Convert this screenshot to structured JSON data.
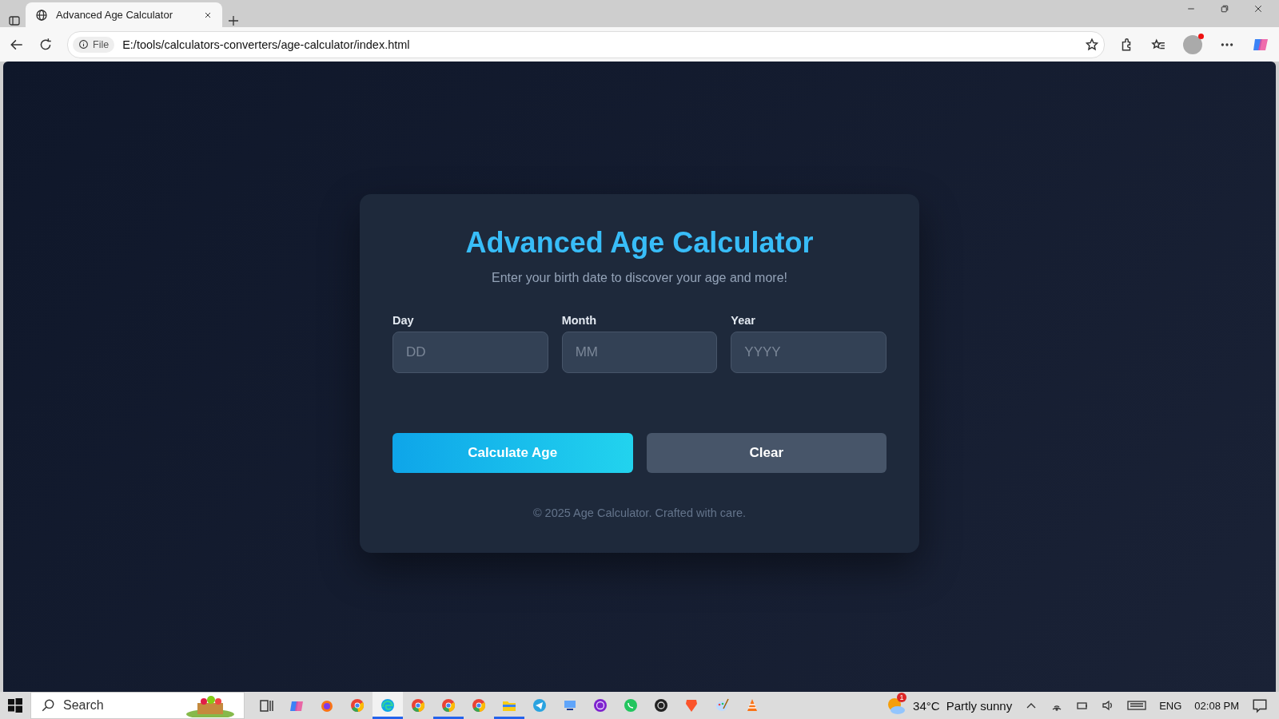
{
  "browser": {
    "tab": {
      "title": "Advanced Age Calculator"
    },
    "address": {
      "scheme_label": "File",
      "url": "E:/tools/calculators-converters/age-calculator/index.html"
    }
  },
  "card": {
    "title": "Advanced Age Calculator",
    "subtitle": "Enter your birth date to discover your age and more!",
    "fields": [
      {
        "label": "Day",
        "placeholder": "DD"
      },
      {
        "label": "Month",
        "placeholder": "MM"
      },
      {
        "label": "Year",
        "placeholder": "YYYY"
      }
    ],
    "buttons": [
      {
        "label": "Calculate Age",
        "kind": "primary"
      },
      {
        "label": "Clear",
        "kind": "secondary"
      }
    ],
    "footer": "© 2025 Age Calculator. Crafted with care."
  },
  "taskbar": {
    "search_placeholder": "Search",
    "apps": [
      {
        "kind": "taskview",
        "running": false,
        "selected": false
      },
      {
        "kind": "copilot",
        "running": false,
        "selected": false
      },
      {
        "kind": "firefox",
        "running": false,
        "selected": false
      },
      {
        "kind": "chrome",
        "running": false,
        "selected": false
      },
      {
        "kind": "edge",
        "running": true,
        "selected": true
      },
      {
        "kind": "chrome",
        "running": false,
        "selected": false
      },
      {
        "kind": "chrome",
        "running": true,
        "selected": false
      },
      {
        "kind": "chrome",
        "running": false,
        "selected": false
      },
      {
        "kind": "folder",
        "running": true,
        "selected": false
      },
      {
        "kind": "telegram",
        "running": false,
        "selected": false
      },
      {
        "kind": "remote",
        "running": false,
        "selected": false
      },
      {
        "kind": "tor",
        "running": false,
        "selected": false
      },
      {
        "kind": "whatsapp",
        "running": false,
        "selected": false
      },
      {
        "kind": "obs",
        "running": false,
        "selected": false
      },
      {
        "kind": "brave",
        "running": false,
        "selected": false
      },
      {
        "kind": "paint",
        "running": false,
        "selected": false
      },
      {
        "kind": "vlc",
        "running": false,
        "selected": false
      }
    ],
    "weather": {
      "badge": "1",
      "temperature": "34°C",
      "condition": "Partly sunny"
    },
    "language": "ENG",
    "time": "02:08 PM"
  }
}
